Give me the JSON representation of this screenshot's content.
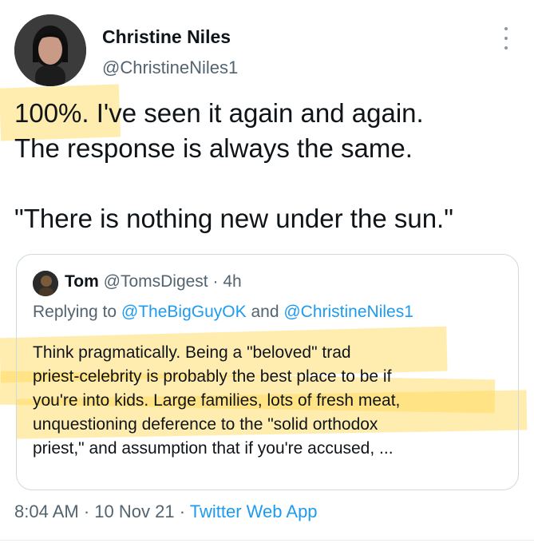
{
  "author": {
    "display_name": "Christine Niles",
    "handle": "@ChristineNiles1",
    "avatar_icon": "profile-photo"
  },
  "tweet": {
    "lines": [
      "100%. I've seen it again and again.",
      "The response is always the same.",
      "\"There is nothing new under the sun.\""
    ]
  },
  "quote": {
    "author_name": "Tom",
    "author_handle": "@TomsDigest",
    "separator": "·",
    "time": "4h",
    "reply_prefix": "Replying to",
    "reply_mention_1": "@TheBigGuyOK",
    "reply_and": "and",
    "reply_mention_2": "@ChristineNiles1",
    "body_lines": [
      "Think pragmatically. Being a \"beloved\" trad",
      "priest-celebrity is probably the best place to be if",
      "you're into kids. Large families, lots of fresh meat,",
      "unquestioning deference to the \"solid orthodox",
      "priest,\" and assumption that if you're accused, ..."
    ]
  },
  "footer": {
    "time": "8:04 AM",
    "sep1": "·",
    "date": "10 Nov 21",
    "sep2": "·",
    "source": "Twitter Web App"
  },
  "colors": {
    "link": "#1d9bf0",
    "secondary_text": "#536471",
    "highlight": "#ffd650"
  }
}
